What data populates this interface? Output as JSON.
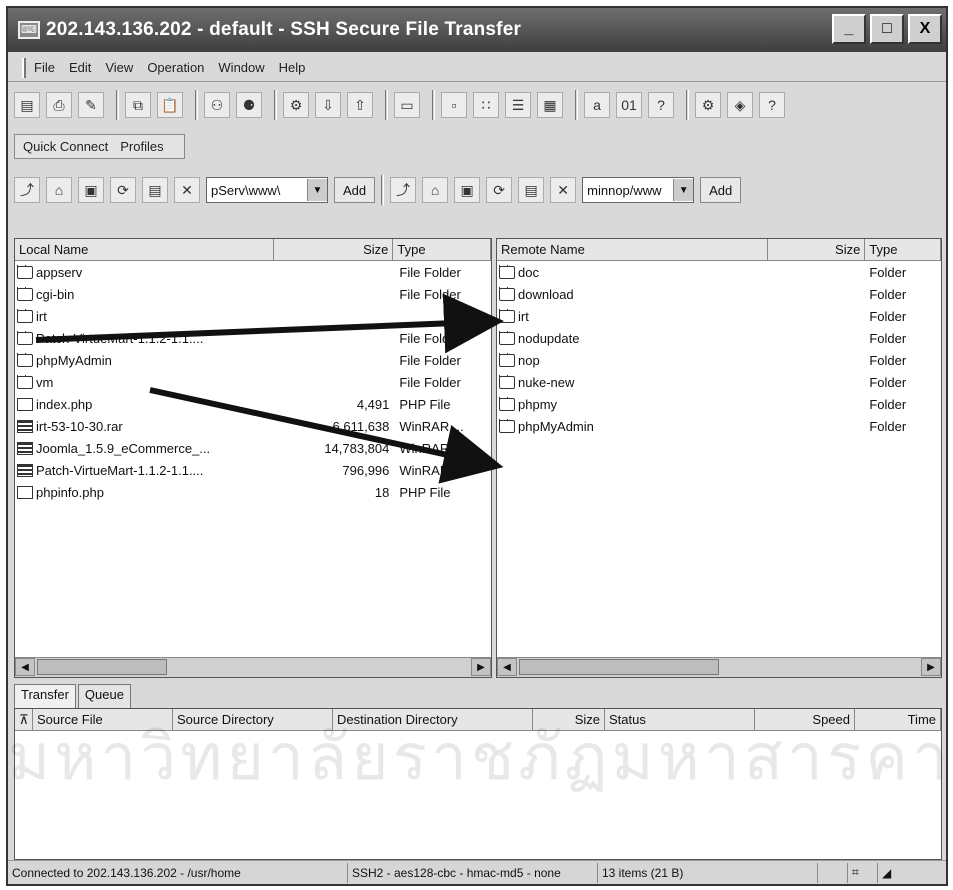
{
  "window": {
    "title": "202.143.136.202 - default - SSH Secure File Transfer",
    "controls": [
      "_",
      "□",
      "X"
    ]
  },
  "menu": [
    "File",
    "Edit",
    "View",
    "Operation",
    "Window",
    "Help"
  ],
  "quick_connect": {
    "connect_label": "Quick Connect",
    "profiles_label": "Profiles"
  },
  "local_toolbar": {
    "path": "pServ\\www\\",
    "add_label": "Add"
  },
  "remote_toolbar": {
    "path": "minnop/www",
    "add_label": "Add"
  },
  "local": {
    "columns": [
      "Local Name",
      "Size",
      "Type"
    ],
    "rows": [
      {
        "name": "appserv",
        "size": "",
        "type": "File Folder",
        "icon": "folder-icon"
      },
      {
        "name": "cgi-bin",
        "size": "",
        "type": "File Folder",
        "icon": "folder-icon"
      },
      {
        "name": "irt",
        "size": "",
        "type": "",
        "icon": "folder-icon"
      },
      {
        "name": "Patch-VirtueMart-1.1.2-1.1....",
        "size": "",
        "type": "File Folder",
        "icon": "folder-icon"
      },
      {
        "name": "phpMyAdmin",
        "size": "",
        "type": "File Folder",
        "icon": "folder-icon"
      },
      {
        "name": "vm",
        "size": "",
        "type": "File Folder",
        "icon": "folder-icon"
      },
      {
        "name": "index.php",
        "size": "4,491",
        "type": "PHP File",
        "icon": "php-file-icon"
      },
      {
        "name": "irt-53-10-30.rar",
        "size": "6,611,638",
        "type": "WinRAR ...",
        "icon": "rar-file-icon"
      },
      {
        "name": "Joomla_1.5.9_eCommerce_...",
        "size": "14,783,804",
        "type": "WinRAR ...",
        "icon": "rar-file-icon"
      },
      {
        "name": "Patch-VirtueMart-1.1.2-1.1....",
        "size": "796,996",
        "type": "WinRAR ...",
        "icon": "rar-file-icon"
      },
      {
        "name": "phpinfo.php",
        "size": "18",
        "type": "PHP File",
        "icon": "php-file-icon"
      }
    ]
  },
  "remote": {
    "columns": [
      "Remote Name",
      "Size",
      "Type"
    ],
    "rows": [
      {
        "name": "doc",
        "type": "Folder"
      },
      {
        "name": "download",
        "type": "Folder"
      },
      {
        "name": "irt",
        "type": "Folder"
      },
      {
        "name": "nodupdate",
        "type": "Folder"
      },
      {
        "name": "nop",
        "type": "Folder"
      },
      {
        "name": "nuke-new",
        "type": "Folder"
      },
      {
        "name": "phpmy",
        "type": "Folder"
      },
      {
        "name": "phpMyAdmin",
        "type": "Folder"
      }
    ]
  },
  "tabs": [
    "Transfer",
    "Queue"
  ],
  "queue_columns": [
    "Source File",
    "Source Directory",
    "Destination Directory",
    "Size",
    "Status",
    "Speed",
    "Time"
  ],
  "status": {
    "connection": "Connected to 202.143.136.202 - /usr/home",
    "cipher": "SSH2 - aes128-cbc - hmac-md5 - none",
    "items": "13 items (21 B)"
  },
  "watermark": "มหาวิทยาลัยราชภัฏมหาสารคาม",
  "colors": {
    "titlebar": "#4a4a4a",
    "arrow": "#111111"
  }
}
